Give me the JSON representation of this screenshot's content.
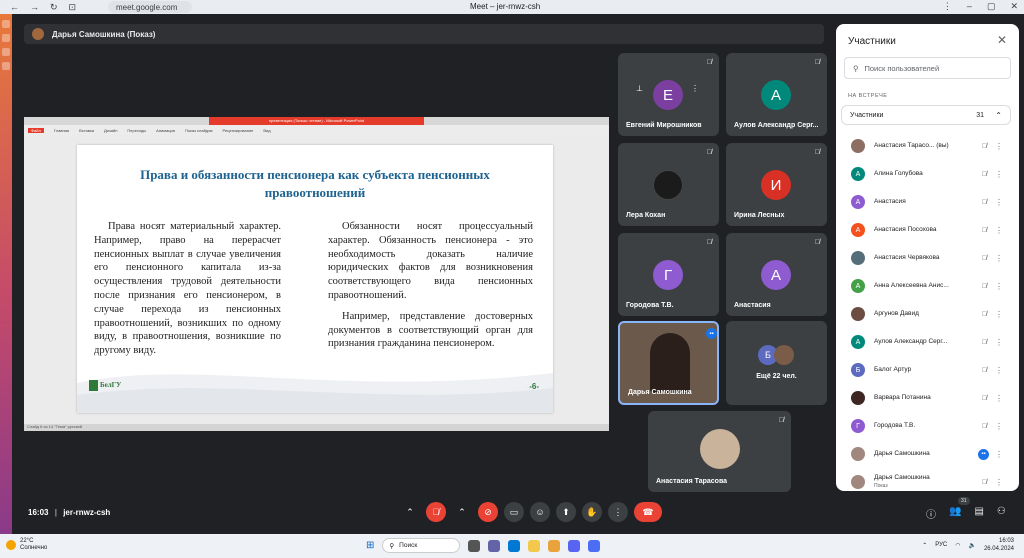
{
  "browser": {
    "url": "meet.google.com",
    "window_title": "Meet – jer-rnwz-csh",
    "nav_icons": [
      "arrow-left-icon",
      "arrow-right-icon",
      "reload-icon",
      "tabs-icon"
    ]
  },
  "presenter": {
    "label": "Дарья Самошкина (Показ)"
  },
  "ppt": {
    "title_bar": "презентация (Только чтение) - Microsoft PowerPoint",
    "ribbon_tabs": [
      "Файл",
      "Главная",
      "Вставка",
      "Дизайн",
      "Переходы",
      "Анимация",
      "Показ слайдов",
      "Рецензирование",
      "Вид"
    ],
    "status": "Слайд 6 из 14   \"Тема\"   русский"
  },
  "slide": {
    "title": "Права и обязанности пенсионера как субъекта пенсионных правоотношений",
    "left_text": "Права носят материальный характер. Например, право на перерасчет пенсионных выплат в случае увеличения его пенсионного капитала из-за осуществления трудовой деятельности после признания его пенсионером, в случае перехода из пенсионных правоотношений, возникших по одному виду, в правоотношения, возникшие по другому виду.",
    "right_text_1": "Обязанности носят процессуальный характер. Обязанность пенсионера - это необходимость доказать наличие юридических фактов для возникновения соответствующего вида пенсионных правоотношений.",
    "right_text_2": "Например, представление достоверных документов в соответствующий орган для признания гражданина пенсионером.",
    "logo_text": "БелГУ",
    "number": "-6-"
  },
  "tiles": [
    {
      "name": "Евгений Мирошников",
      "initial": "Е",
      "color": "#7b3fa0"
    },
    {
      "name": "Аулов Александр Серг...",
      "initial": "А",
      "color": "#00897b"
    },
    {
      "name": "Лера Кохан"
    },
    {
      "name": "Ирина Лесных",
      "initial": "И",
      "color": "#d93025"
    },
    {
      "name": "Городова Т.В.",
      "initial": "Г",
      "color": "#8e5bd0"
    },
    {
      "name": "Анастасия",
      "initial": "А",
      "color": "#8e5bd0"
    },
    {
      "name": "Дарья Самошкина"
    },
    {
      "name": "Ещё 22 чел.",
      "initial": "Б",
      "color": "#5c6bc0"
    },
    {
      "name": "Анастасия Тарасова"
    }
  ],
  "panel": {
    "title": "Участники",
    "search_placeholder": "Поиск пользователей",
    "section_label": "НА ВСТРЕЧЕ",
    "group_label": "Участники",
    "count": "31",
    "participants": [
      {
        "name": "Анастасия Тарасо... (вы)",
        "initial": "",
        "color": "#8d6e63",
        "mic": "muted"
      },
      {
        "name": "Алина Голубова",
        "initial": "А",
        "color": "#00897b",
        "mic": "muted"
      },
      {
        "name": "Анастасия",
        "initial": "А",
        "color": "#8e5bd0",
        "mic": "muted"
      },
      {
        "name": "Анастасия Посохова",
        "initial": "А",
        "color": "#f4511e",
        "mic": "muted"
      },
      {
        "name": "Анастасия Червякова",
        "initial": "",
        "color": "#546e7a",
        "mic": "muted"
      },
      {
        "name": "Анна Алексеевна Анис...",
        "initial": "А",
        "color": "#43a047",
        "mic": "muted"
      },
      {
        "name": "Аргунов Давид",
        "initial": "",
        "color": "#6d4c41",
        "mic": "muted"
      },
      {
        "name": "Аулов Александр Серг...",
        "initial": "А",
        "color": "#00897b",
        "mic": "muted"
      },
      {
        "name": "Балог Артур",
        "initial": "Б",
        "color": "#5c6bc0",
        "mic": "muted"
      },
      {
        "name": "Варвара Потанина",
        "initial": "",
        "color": "#3e2723",
        "mic": "muted"
      },
      {
        "name": "Городова Т.В.",
        "initial": "Г",
        "color": "#8e5bd0",
        "mic": "muted"
      },
      {
        "name": "Дарья Самошкина",
        "initial": "",
        "color": "#a1887f",
        "mic": "live"
      },
      {
        "name": "Дарья Самошкина",
        "sub": "Показ",
        "initial": "",
        "color": "#a1887f",
        "mic": "muted"
      }
    ]
  },
  "bottom": {
    "time": "16:03",
    "meeting_code": "jer-rnwz-csh",
    "participants_badge": "31"
  },
  "taskbar": {
    "temp": "22°C",
    "weather": "Солнечно",
    "search": "Поиск",
    "lang": "РУС",
    "time": "16:03",
    "date": "26.04.2024"
  }
}
